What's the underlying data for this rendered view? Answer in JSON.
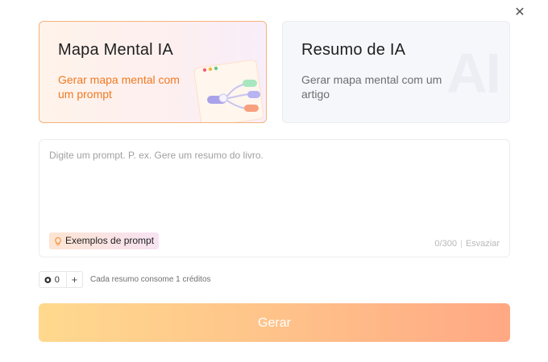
{
  "dialog": {
    "close_icon": "close-icon"
  },
  "modes": [
    {
      "title": "Mapa Mental IA",
      "description": "Gerar mapa mental com um prompt",
      "selected": true
    },
    {
      "title": "Resumo de IA",
      "description": "Gerar mapa mental com um artigo",
      "selected": false,
      "watermark": "AI"
    }
  ],
  "prompt": {
    "placeholder": "Digite um prompt. P. ex. Gere um resumo do livro.",
    "value": "",
    "examples_label": "Exemplos de prompt",
    "examples_icon": "lightbulb-icon",
    "char_count": "0/300",
    "separator": "|",
    "clear_label": "Esvaziar"
  },
  "credits": {
    "count": "0",
    "plus_label": "+",
    "note": "Cada resumo consome 1 créditos",
    "icon": "coin-icon"
  },
  "generate_label": "Gerar",
  "colors": {
    "accent": "#f07a22",
    "active_border": "#f7b27a",
    "button_gradient_start": "#ffd98e",
    "button_gradient_end": "#ffa884"
  }
}
